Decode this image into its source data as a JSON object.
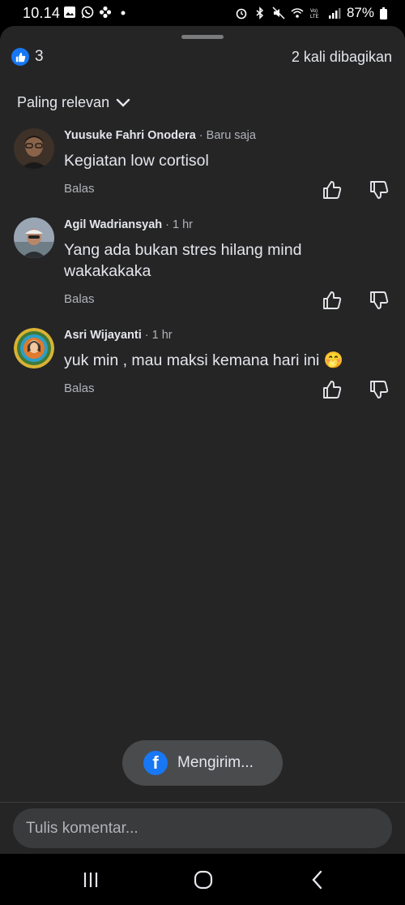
{
  "status_bar": {
    "time": "10.14",
    "battery": "87%",
    "left_icons": [
      "gallery-icon",
      "whatsapp-icon",
      "flower-icon",
      "dot-icon"
    ],
    "right_icons": [
      "alarm-icon",
      "bluetooth-icon",
      "mute-icon",
      "wifi-icon",
      "volte-icon",
      "signal-icon",
      "battery-icon"
    ]
  },
  "summary": {
    "like_count": "3",
    "shares": "2 kali dibagikan"
  },
  "sort": {
    "label": "Paling relevan"
  },
  "comments": [
    {
      "name": "Yuusuke Fahri Onodera",
      "time": " · Baru saja",
      "text": "Kegiatan low cortisol",
      "reply": "Balas"
    },
    {
      "name": "Agil Wadriansyah",
      "time": " · 1 hr",
      "text": "Yang ada bukan stres hilang mind wakakakaka",
      "reply": "Balas"
    },
    {
      "name": "Asri Wijayanti",
      "time": " · 1 hr",
      "text": "yuk min , mau maksi kemana hari ini 🤭",
      "reply": "Balas"
    }
  ],
  "toast": {
    "label": "Mengirim..."
  },
  "composer": {
    "placeholder": "Tulis komentar..."
  },
  "colors": {
    "sheet_bg": "#252526",
    "accent": "#1877f2",
    "muted_text": "#b0b3b8"
  }
}
